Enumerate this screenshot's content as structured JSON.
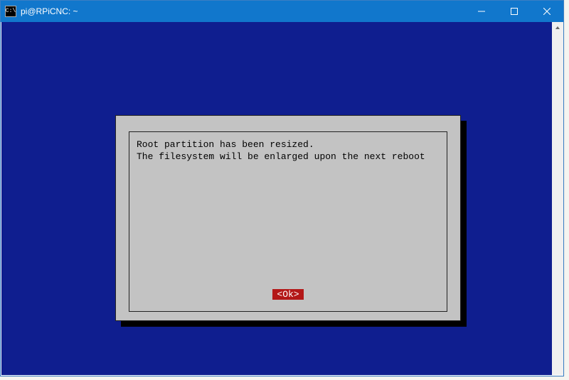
{
  "titlebar": {
    "icon_glyph": "C:\\",
    "title": "pi@RPiCNC: ~"
  },
  "dialog": {
    "line1": "Root partition has been resized.",
    "line2": "The filesystem will be enlarged upon the next reboot",
    "ok_label": "<Ok>"
  },
  "colors": {
    "titlebar_bg": "#1177cc",
    "terminal_bg": "#0f1e8f",
    "dialog_bg": "#c3c3c3",
    "ok_bg": "#b31717"
  }
}
